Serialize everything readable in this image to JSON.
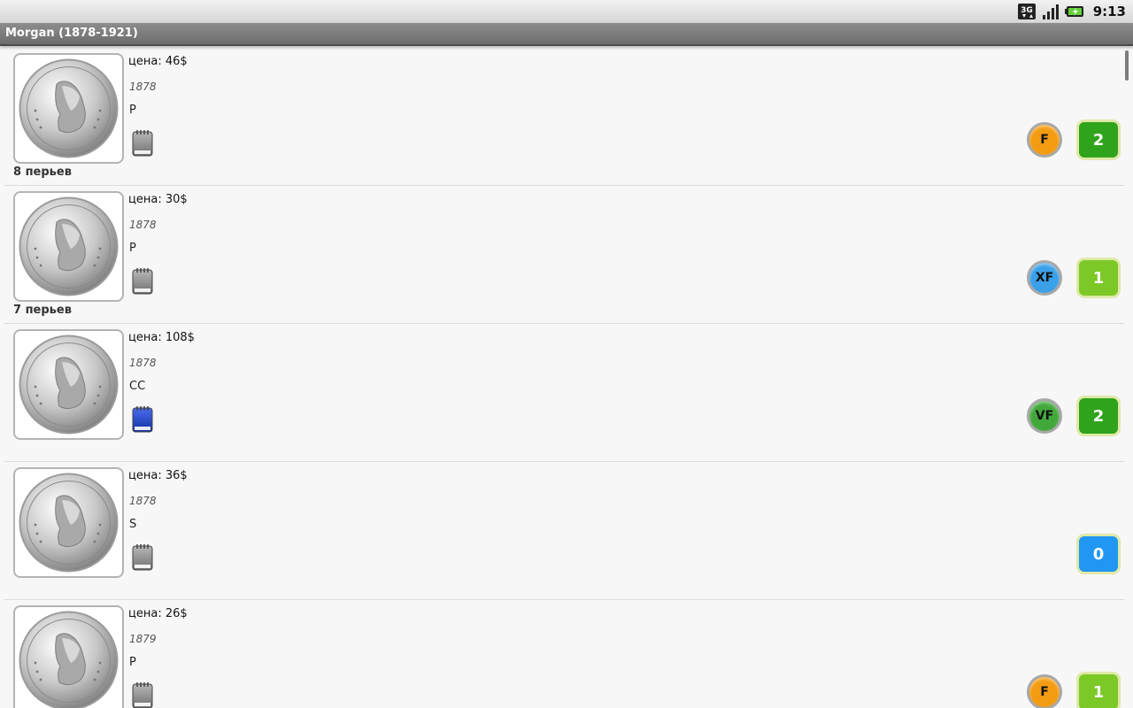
{
  "status": {
    "time": "9:13",
    "network_label": "3G"
  },
  "title": "Morgan (1878-1921)",
  "colors": {
    "grade_F": "#f39c12",
    "grade_XF": "#3aa0e8",
    "grade_VF": "#43a83c",
    "count_2": "#2fa31c",
    "count_1": "#7cc826",
    "count_0": "#2196f3",
    "book_gray": "#8a8a8a",
    "book_blue": "#1f3fbf"
  },
  "coins": [
    {
      "price": "цена: 46$",
      "year": "1878",
      "mint": "P",
      "book": "gray-book-icon",
      "grade": "F",
      "count": "2",
      "feathers": "8 перьев"
    },
    {
      "price": "цена: 30$",
      "year": "1878",
      "mint": "P",
      "book": "gray-book-icon",
      "grade": "XF",
      "count": "1",
      "feathers": "7 перьев"
    },
    {
      "price": "цена: 108$",
      "year": "1878",
      "mint": "CC",
      "book": "blue-book-icon",
      "grade": "VF",
      "count": "2",
      "feathers": ""
    },
    {
      "price": "цена: 36$",
      "year": "1878",
      "mint": "S",
      "book": "gray-book-icon",
      "grade": "",
      "count": "0",
      "feathers": ""
    },
    {
      "price": "цена: 26$",
      "year": "1879",
      "mint": "P",
      "book": "gray-book-icon",
      "grade": "F",
      "count": "1",
      "feathers": ""
    }
  ]
}
